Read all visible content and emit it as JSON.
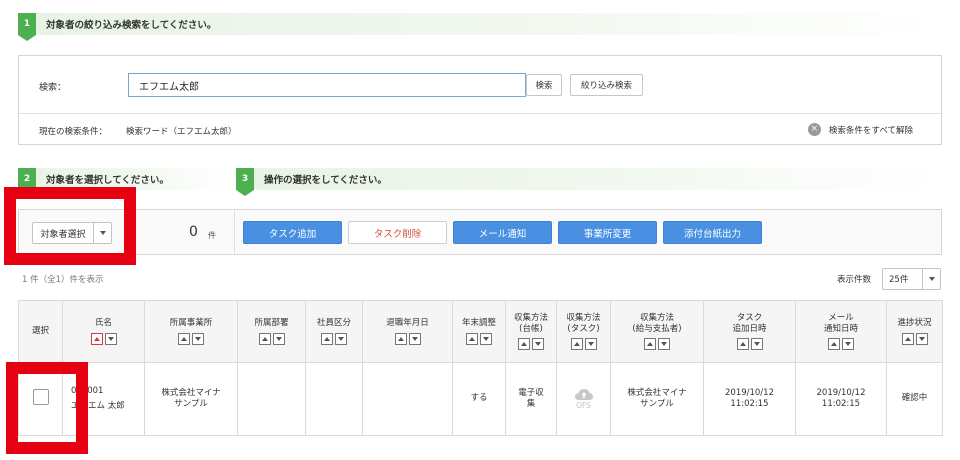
{
  "steps": {
    "s1": {
      "num": "1",
      "text": "対象者の絞り込み検索をしてください。"
    },
    "s2": {
      "num": "2",
      "text": "対象者を選択してください。"
    },
    "s3": {
      "num": "3",
      "text": "操作の選択をしてください。"
    }
  },
  "search": {
    "label": "検索：",
    "value": "エフエム太郎",
    "search_button": "検索",
    "filter_button": "絞り込み検索",
    "condition_label": "現在の検索条件：",
    "condition_value": "検索ワード（エフエム太郎）",
    "clear_label": "検索条件をすべて解除"
  },
  "selection": {
    "target_select": "対象者選択",
    "count": "0",
    "count_unit": "件"
  },
  "actions": [
    {
      "label": "タスク追加",
      "style": "blue"
    },
    {
      "label": "タスク削除",
      "style": "red-outline"
    },
    {
      "label": "メール通知",
      "style": "blue"
    },
    {
      "label": "事業所変更",
      "style": "blue"
    },
    {
      "label": "添付台紙出力",
      "style": "blue"
    }
  ],
  "list": {
    "count_note": "1 件（全1）件を表示",
    "per_page_label": "表示件数",
    "per_page_value": "25件"
  },
  "table": {
    "headers": [
      {
        "label": "選択",
        "sortable": false
      },
      {
        "label": "氏名",
        "sortable": true,
        "active": "up"
      },
      {
        "label": "所属事業所",
        "sortable": true
      },
      {
        "label": "所属部署",
        "sortable": true
      },
      {
        "label": "社員区分",
        "sortable": true
      },
      {
        "label": "退職年月日",
        "sortable": true
      },
      {
        "label": "年末調整",
        "sortable": true
      },
      {
        "label": "収集方法\n(台帳)",
        "sortable": true
      },
      {
        "label": "収集方法\n(タスク)",
        "sortable": true
      },
      {
        "label": "収集方法\n(給与支払者)",
        "sortable": true
      },
      {
        "label": "タスク\n追加日時",
        "sortable": true
      },
      {
        "label": "メール\n通知日時",
        "sortable": true
      },
      {
        "label": "進捗状況",
        "sortable": true
      }
    ],
    "rows": [
      {
        "name_id": "000001",
        "name": "エフエム 太郎",
        "office": "株式会社マイナ\nサンプル",
        "department": "",
        "employee_type": "",
        "retire_date": "",
        "year_end": "する",
        "method_ledger": "電子収\n集",
        "method_task": "OFS",
        "method_payer": "株式会社マイナ\nサンプル",
        "task_added": "2019/10/12\n11:02:15",
        "mail_sent": "2019/10/12\n11:02:15",
        "status": "確認中"
      }
    ]
  },
  "colors": {
    "step_green": "#4caf50",
    "action_blue": "#4a90e2",
    "highlight_red": "#e60012",
    "delete_red": "#d94a3b"
  }
}
